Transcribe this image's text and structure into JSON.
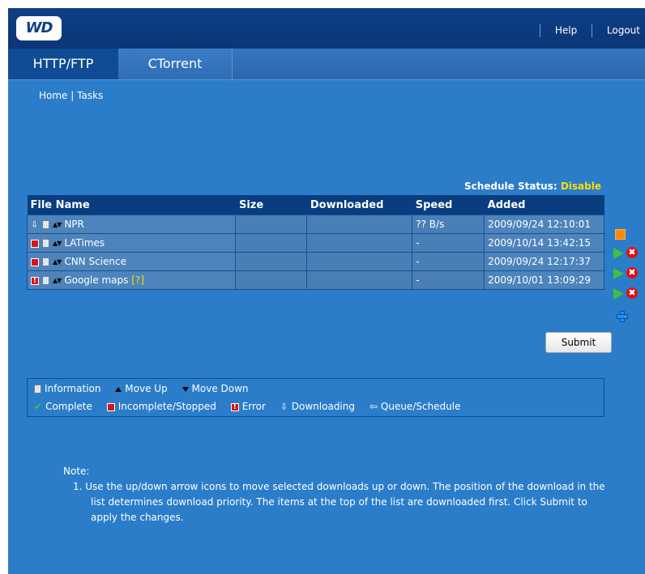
{
  "header": {
    "logo_text": "WD",
    "links": [
      "Help",
      "Logout"
    ]
  },
  "tabs": [
    {
      "label": "HTTP/FTP",
      "active": true
    },
    {
      "label": "CTorrent",
      "active": false
    }
  ],
  "breadcrumb": {
    "home": "Home",
    "sep": "|",
    "tasks": "Tasks"
  },
  "schedule": {
    "label": "Schedule Status:",
    "value": "Disable"
  },
  "table": {
    "columns": [
      "File Name",
      "Size",
      "Downloaded",
      "Speed",
      "Added"
    ],
    "rows": [
      {
        "status": "downloading",
        "name": "NPR",
        "size": "",
        "downloaded": "",
        "speed": "?? B/s",
        "added": "2009/09/24 12:10:01",
        "actions": [
          "stop"
        ]
      },
      {
        "status": "incomplete",
        "name": "LATimes",
        "size": "",
        "downloaded": "",
        "speed": "-",
        "added": "2009/10/14 13:42:15",
        "actions": [
          "play",
          "delete"
        ]
      },
      {
        "status": "incomplete",
        "name": "CNN Science",
        "size": "",
        "downloaded": "",
        "speed": "-",
        "added": "2009/09/24 12:17:37",
        "actions": [
          "play",
          "delete"
        ]
      },
      {
        "status": "error",
        "name": "Google maps",
        "help_mark": "[?]",
        "size": "",
        "downloaded": "",
        "speed": "-",
        "added": "2009/10/01 13:09:29",
        "actions": [
          "play",
          "delete"
        ]
      }
    ]
  },
  "submit_label": "Submit",
  "legend": {
    "information": "Information",
    "move_up": "Move Up",
    "move_down": "Move Down",
    "complete": "Complete",
    "incomplete": "Incomplete/Stopped",
    "error": "Error",
    "downloading": "Downloading",
    "queue": "Queue/Schedule"
  },
  "note": {
    "title": "Note:",
    "items": [
      "1.  Use the up/down arrow icons to move selected downloads up or down. The position of the download in the list determines download priority. The items at the top of the list are downloaded first. Click Submit to apply the changes."
    ]
  },
  "colors": {
    "background": "#2b7dc9",
    "header": "#0e3f86",
    "accent_yellow": "#ffde00",
    "error_red": "#d21717",
    "play_green": "#3cc23c",
    "stop_orange": "#ff8a00"
  }
}
